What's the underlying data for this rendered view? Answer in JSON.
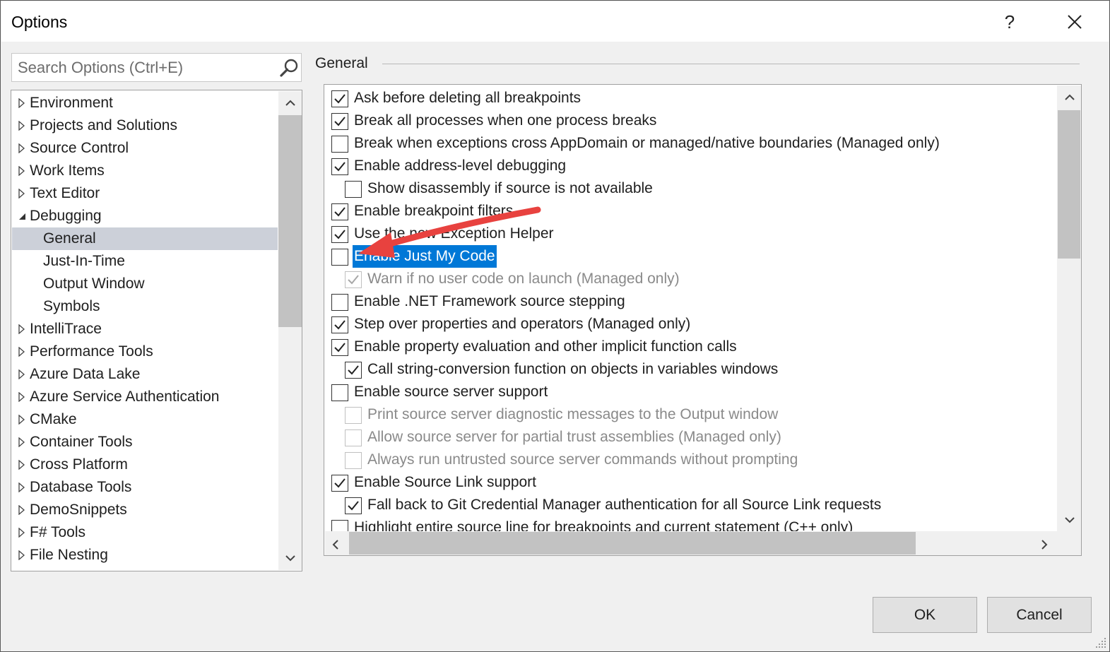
{
  "window": {
    "title": "Options",
    "help_glyph": "?",
    "close_icon": "close-icon"
  },
  "search": {
    "placeholder": "Search Options (Ctrl+E)",
    "value": "",
    "icon": "search-icon"
  },
  "tree": {
    "items": [
      {
        "label": "Environment",
        "level": 0,
        "expander": "collapsed"
      },
      {
        "label": "Projects and Solutions",
        "level": 0,
        "expander": "collapsed"
      },
      {
        "label": "Source Control",
        "level": 0,
        "expander": "collapsed"
      },
      {
        "label": "Work Items",
        "level": 0,
        "expander": "collapsed"
      },
      {
        "label": "Text Editor",
        "level": 0,
        "expander": "collapsed"
      },
      {
        "label": "Debugging",
        "level": 0,
        "expander": "expanded"
      },
      {
        "label": "General",
        "level": 1,
        "expander": "none",
        "selected": true
      },
      {
        "label": "Just-In-Time",
        "level": 1,
        "expander": "none"
      },
      {
        "label": "Output Window",
        "level": 1,
        "expander": "none"
      },
      {
        "label": "Symbols",
        "level": 1,
        "expander": "none"
      },
      {
        "label": "IntelliTrace",
        "level": 0,
        "expander": "collapsed"
      },
      {
        "label": "Performance Tools",
        "level": 0,
        "expander": "collapsed"
      },
      {
        "label": "Azure Data Lake",
        "level": 0,
        "expander": "collapsed"
      },
      {
        "label": "Azure Service Authentication",
        "level": 0,
        "expander": "collapsed"
      },
      {
        "label": "CMake",
        "level": 0,
        "expander": "collapsed"
      },
      {
        "label": "Container Tools",
        "level": 0,
        "expander": "collapsed"
      },
      {
        "label": "Cross Platform",
        "level": 0,
        "expander": "collapsed"
      },
      {
        "label": "Database Tools",
        "level": 0,
        "expander": "collapsed"
      },
      {
        "label": "DemoSnippets",
        "level": 0,
        "expander": "collapsed"
      },
      {
        "label": "F# Tools",
        "level": 0,
        "expander": "collapsed"
      },
      {
        "label": "File Nesting",
        "level": 0,
        "expander": "collapsed"
      }
    ]
  },
  "section": {
    "title": "General"
  },
  "options": [
    {
      "label": "Ask before deleting all breakpoints",
      "checked": true,
      "indent": 0,
      "disabled": false
    },
    {
      "label": "Break all processes when one process breaks",
      "checked": true,
      "indent": 0,
      "disabled": false
    },
    {
      "label": "Break when exceptions cross AppDomain or managed/native boundaries (Managed only)",
      "checked": false,
      "indent": 0,
      "disabled": false
    },
    {
      "label": "Enable address-level debugging",
      "checked": true,
      "indent": 0,
      "disabled": false
    },
    {
      "label": "Show disassembly if source is not available",
      "checked": false,
      "indent": 1,
      "disabled": false
    },
    {
      "label": "Enable breakpoint filters",
      "checked": true,
      "indent": 0,
      "disabled": false
    },
    {
      "label": "Use the new Exception Helper",
      "checked": true,
      "indent": 0,
      "disabled": false
    },
    {
      "label": "Enable Just My Code",
      "checked": false,
      "indent": 0,
      "disabled": false,
      "highlighted": true
    },
    {
      "label": "Warn if no user code on launch (Managed only)",
      "checked": true,
      "indent": 1,
      "disabled": true
    },
    {
      "label": "Enable .NET Framework source stepping",
      "checked": false,
      "indent": 0,
      "disabled": false
    },
    {
      "label": "Step over properties and operators (Managed only)",
      "checked": true,
      "indent": 0,
      "disabled": false
    },
    {
      "label": "Enable property evaluation and other implicit function calls",
      "checked": true,
      "indent": 0,
      "disabled": false
    },
    {
      "label": "Call string-conversion function on objects in variables windows",
      "checked": true,
      "indent": 1,
      "disabled": false
    },
    {
      "label": "Enable source server support",
      "checked": false,
      "indent": 0,
      "disabled": false
    },
    {
      "label": "Print source server diagnostic messages to the Output window",
      "checked": false,
      "indent": 1,
      "disabled": true
    },
    {
      "label": "Allow source server for partial trust assemblies (Managed only)",
      "checked": false,
      "indent": 1,
      "disabled": true
    },
    {
      "label": "Always run untrusted source server commands without prompting",
      "checked": false,
      "indent": 1,
      "disabled": true
    },
    {
      "label": "Enable Source Link support",
      "checked": true,
      "indent": 0,
      "disabled": false
    },
    {
      "label": "Fall back to Git Credential Manager authentication for all Source Link requests",
      "checked": true,
      "indent": 1,
      "disabled": false
    },
    {
      "label": "Highlight entire source line for breakpoints and current statement (C++ only)",
      "checked": false,
      "indent": 0,
      "disabled": false
    }
  ],
  "annotation": {
    "color": "#e8423f"
  },
  "colors": {
    "selection_highlight": "#0078d7",
    "tree_selected": "#ccd0d9",
    "button_face": "#e1e1e1"
  },
  "buttons": {
    "ok": "OK",
    "cancel": "Cancel"
  }
}
